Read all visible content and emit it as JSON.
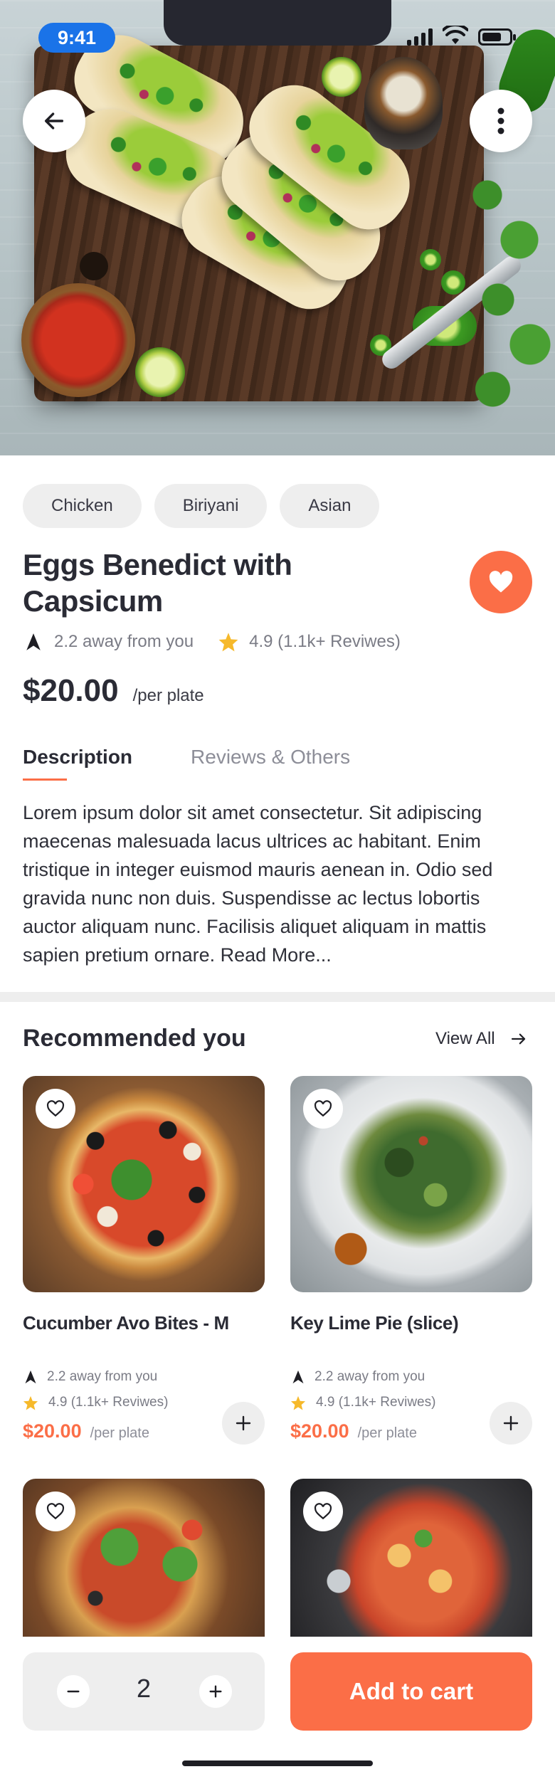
{
  "status_bar": {
    "time": "9:41"
  },
  "product": {
    "tags": [
      "Chicken",
      "Biriyani",
      "Asian"
    ],
    "title": "Eggs Benedict with Capsicum",
    "distance": "2.2 away from you",
    "rating": "4.9 (1.1k+ Reviwes)",
    "price": "$20.00",
    "price_unit": "/per plate"
  },
  "tabs": [
    {
      "label": "Description",
      "active": true
    },
    {
      "label": "Reviews & Others",
      "active": false
    }
  ],
  "description": "Lorem ipsum dolor sit amet consectetur. Sit adipiscing maecenas malesuada lacus ultrices ac habitant. Enim tristique in integer euismod mauris aenean in. Odio sed gravida nunc non duis. Suspendisse ac lectus lobortis auctor aliquam nunc. Facilisis aliquet aliquam in mattis sapien pretium ornare. Read More...",
  "recommended": {
    "title": "Recommended you",
    "view_all": "View All",
    "items": [
      {
        "name": "Cucumber Avo Bites - M",
        "distance": "2.2 away from you",
        "rating": "4.9 (1.1k+ Reviwes)",
        "price": "$20.00",
        "unit": "/per plate"
      },
      {
        "name": "Key Lime Pie (slice)",
        "distance": "2.2 away from you",
        "rating": "4.9 (1.1k+ Reviwes)",
        "price": "$20.00",
        "unit": "/per plate"
      }
    ]
  },
  "cart": {
    "quantity": "2",
    "add_label": "Add to cart"
  },
  "colors": {
    "accent": "#fb6e47",
    "star": "#f6b92b",
    "chip_bg": "#eeeeee",
    "status_pill": "#1a73e8"
  }
}
